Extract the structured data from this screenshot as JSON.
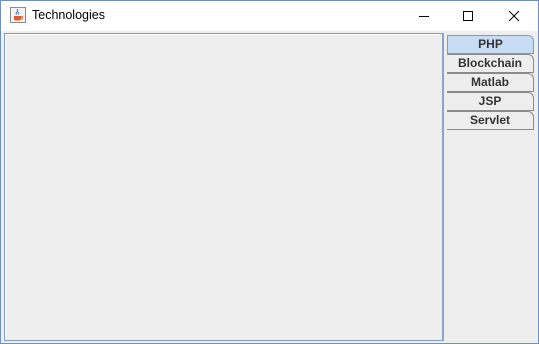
{
  "window": {
    "title": "Technologies"
  },
  "icons": {
    "app": "java-coffee-cup-icon",
    "minimize": "minimize-icon",
    "maximize": "maximize-icon",
    "close": "close-icon"
  },
  "tabs": [
    {
      "label": "PHP",
      "selected": true
    },
    {
      "label": "Blockchain",
      "selected": false
    },
    {
      "label": "Matlab",
      "selected": false
    },
    {
      "label": "JSP",
      "selected": false
    },
    {
      "label": "Servlet",
      "selected": false
    }
  ],
  "colors": {
    "selected_tab": "#c8dcf4",
    "tab_background": "#eeeeee",
    "panel_border": "#7a9cc9"
  }
}
